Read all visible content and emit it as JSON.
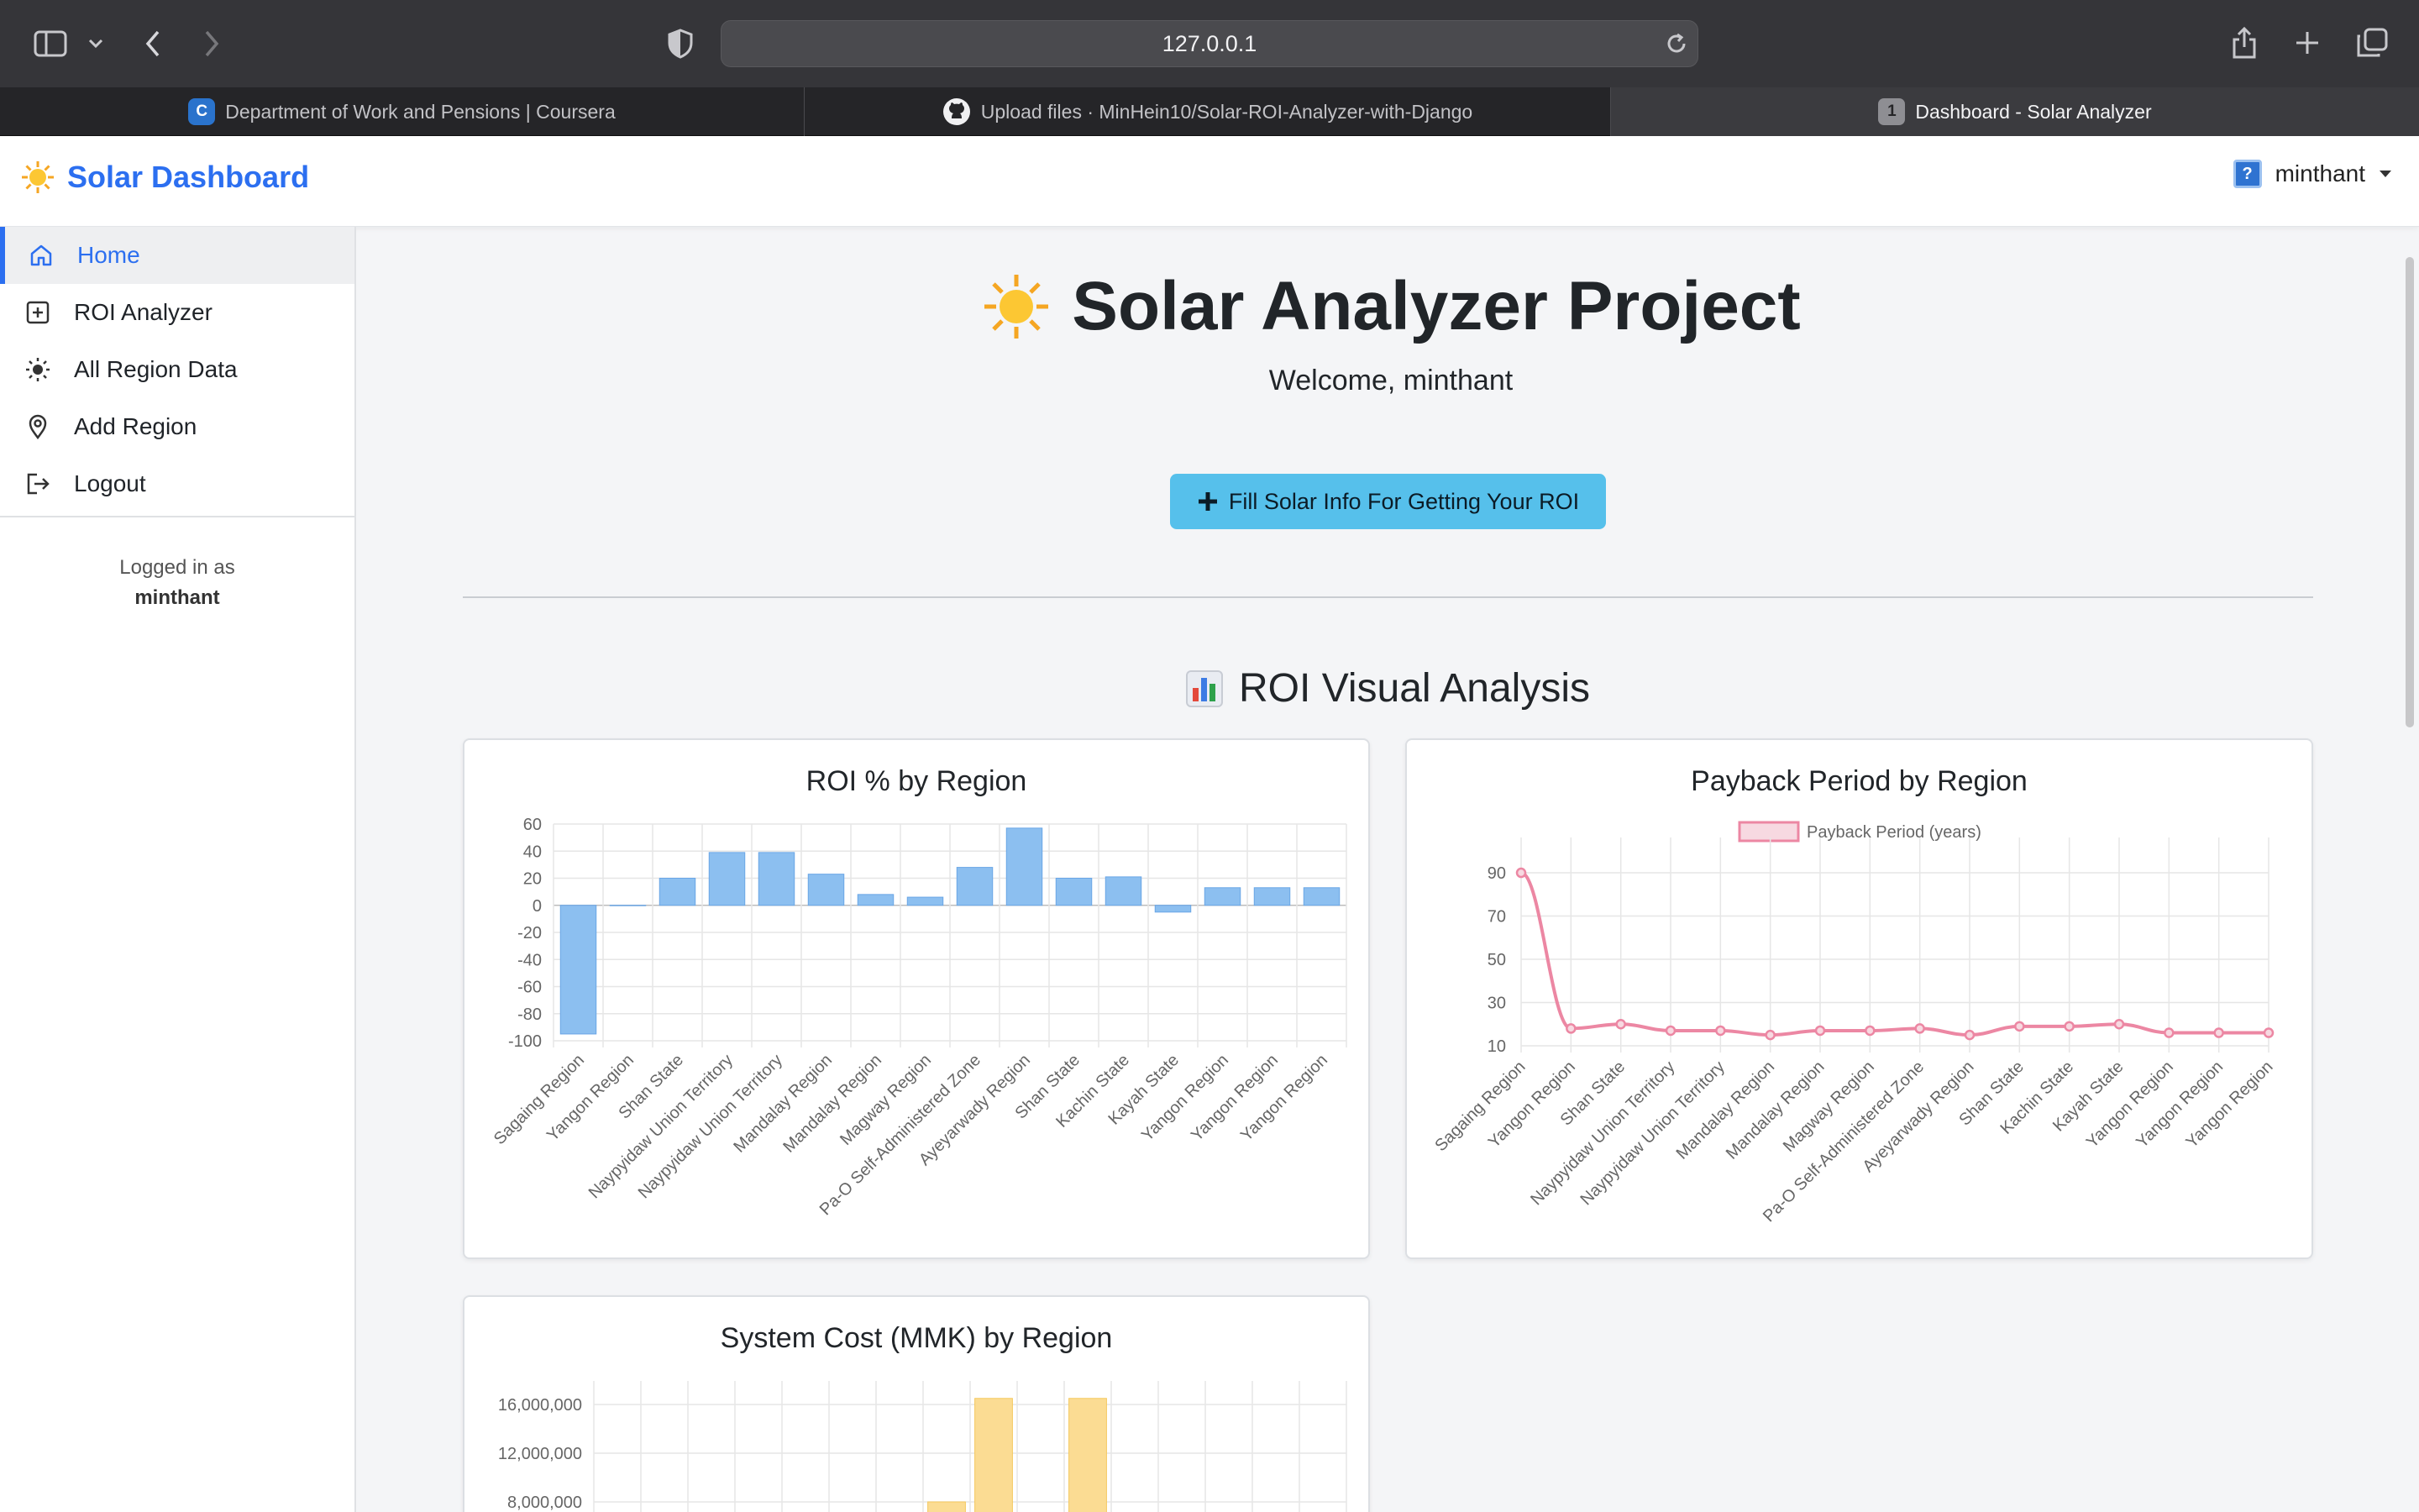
{
  "browser": {
    "url": "127.0.0.1",
    "tabs": [
      {
        "title": "Department of Work and Pensions | Coursera",
        "badge": "C"
      },
      {
        "title": "Upload files · MinHein10/Solar-ROI-Analyzer-with-Django",
        "badge": "gh"
      },
      {
        "title": "Dashboard - Solar Analyzer",
        "badge": "1"
      }
    ]
  },
  "header": {
    "brand": "Solar Dashboard",
    "username": "minthant",
    "avatar_glyph": "?"
  },
  "sidebar": {
    "items": [
      {
        "label": "Home",
        "icon": "home-icon"
      },
      {
        "label": "ROI Analyzer",
        "icon": "plus-square-icon"
      },
      {
        "label": "All Region Data",
        "icon": "sun-icon"
      },
      {
        "label": "Add Region",
        "icon": "map-pin-icon"
      },
      {
        "label": "Logout",
        "icon": "logout-icon"
      }
    ],
    "logged_in_label": "Logged in as",
    "logged_in_user": "minthant"
  },
  "main": {
    "title": "Solar Analyzer Project",
    "welcome": "Welcome, minthant",
    "cta_label": "Fill Solar Info For Getting Your ROI",
    "section_title": "ROI Visual Analysis"
  },
  "colors": {
    "accent": "#2c6ff0",
    "cta": "#56c0eb",
    "bar_blue": "#8cbff0",
    "line_pink": "#ec87a3",
    "bar_yellow": "#fbdc93"
  },
  "chart_data": [
    {
      "type": "bar",
      "title": "ROI % by Region",
      "categories": [
        "Sagaing Region",
        "Yangon Region",
        "Shan State",
        "Naypyidaw Union Territory",
        "Naypyidaw Union Territory",
        "Mandalay Region",
        "Mandalay Region",
        "Magway Region",
        "Pa-O Self-Administered Zone",
        "Ayeyarwady Region",
        "Shan State",
        "Kachin State",
        "Kayah State",
        "Yangon Region",
        "Yangon Region",
        "Yangon Region"
      ],
      "values": [
        -95,
        0,
        20,
        39,
        39,
        23,
        8,
        6,
        28,
        57,
        20,
        21,
        -5,
        13,
        13,
        13
      ],
      "ylim": [
        -100,
        60
      ],
      "yticks": [
        "60",
        "40",
        "20",
        "0",
        "-20",
        "-40",
        "-60",
        "-80",
        "-100"
      ],
      "grid": true
    },
    {
      "type": "line",
      "title": "Payback Period by Region",
      "legend": [
        "Payback Period (years)"
      ],
      "categories": [
        "Sagaing Region",
        "Yangon Region",
        "Shan State",
        "Naypyidaw Union Territory",
        "Naypyidaw Union Territory",
        "Mandalay Region",
        "Mandalay Region",
        "Magway Region",
        "Pa-O Self-Administered Zone",
        "Ayeyarwady Region",
        "Shan State",
        "Kachin State",
        "Kayah State",
        "Yangon Region",
        "Yangon Region",
        "Yangon Region"
      ],
      "values": [
        90,
        18,
        20,
        17,
        17,
        15,
        17,
        17,
        18,
        15,
        19,
        19,
        20,
        16,
        16,
        16
      ],
      "ylim": [
        10,
        97
      ],
      "yticks": [
        "90",
        "70",
        "50",
        "30",
        "10"
      ],
      "grid": true
    },
    {
      "type": "bar",
      "title": "System Cost (MMK) by Region",
      "yticks": [
        "16,000,000",
        "12,000,000",
        "8,000,000"
      ],
      "values": [
        0,
        0,
        0,
        0,
        0,
        0,
        0,
        8000000,
        16500000,
        0,
        16500000,
        0,
        0,
        0,
        0,
        0
      ],
      "grid": true
    }
  ]
}
